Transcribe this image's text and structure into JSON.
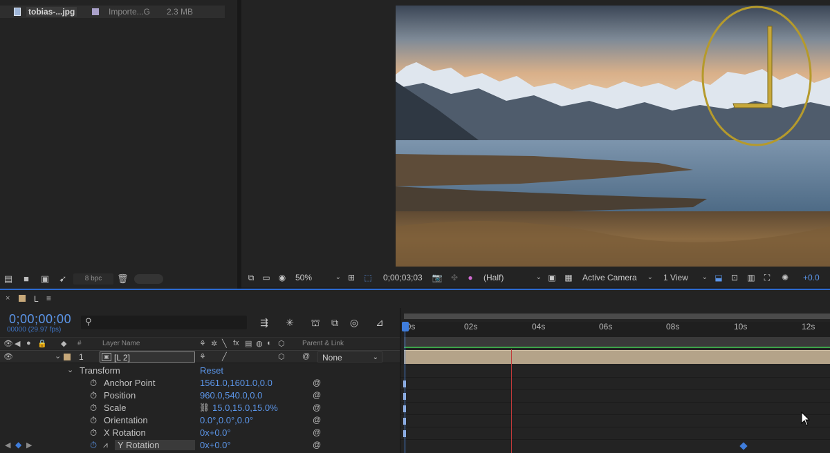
{
  "project": {
    "item": {
      "name": "tobias-...jpg",
      "type": "Importe...G",
      "size": "2.3 MB"
    },
    "footer": {
      "bpc": "8 bpc"
    }
  },
  "viewer": {
    "zoom": "50%",
    "timecode": "0;00;03;03",
    "resolution": "(Half)",
    "camera": "Active Camera",
    "views": "1 View",
    "exposure": "+0.0"
  },
  "timeline": {
    "comp_name": "L",
    "timecode": "0;00;00;00",
    "frames": "00000 (29.97 fps)",
    "columns": {
      "number": "#",
      "layer_name": "Layer Name",
      "parent": "Parent & Link"
    },
    "layer": {
      "index": "1",
      "name": "[L 2]",
      "parent": "None"
    },
    "transform": {
      "label": "Transform",
      "reset": "Reset"
    },
    "properties": [
      {
        "name": "Anchor Point",
        "value": "1561.0,1601.0,0.0"
      },
      {
        "name": "Position",
        "value": "960.0,540.0,0.0"
      },
      {
        "name": "Scale",
        "value": "15.0,15.0,15.0%"
      },
      {
        "name": "Orientation",
        "value": "0.0°,0.0°,0.0°"
      },
      {
        "name": "X Rotation",
        "value": "0x+0.0°"
      },
      {
        "name": "Y Rotation",
        "value": "0x+0.0°"
      }
    ],
    "ruler_ticks": [
      "00s",
      "02s",
      "04s",
      "06s",
      "08s",
      "10s",
      "12s"
    ]
  },
  "colors": {
    "accent": "#5b95e8",
    "label": "#c8a97a",
    "layer_bar": "#b4a389",
    "playhead_red": "#c23a3a"
  }
}
